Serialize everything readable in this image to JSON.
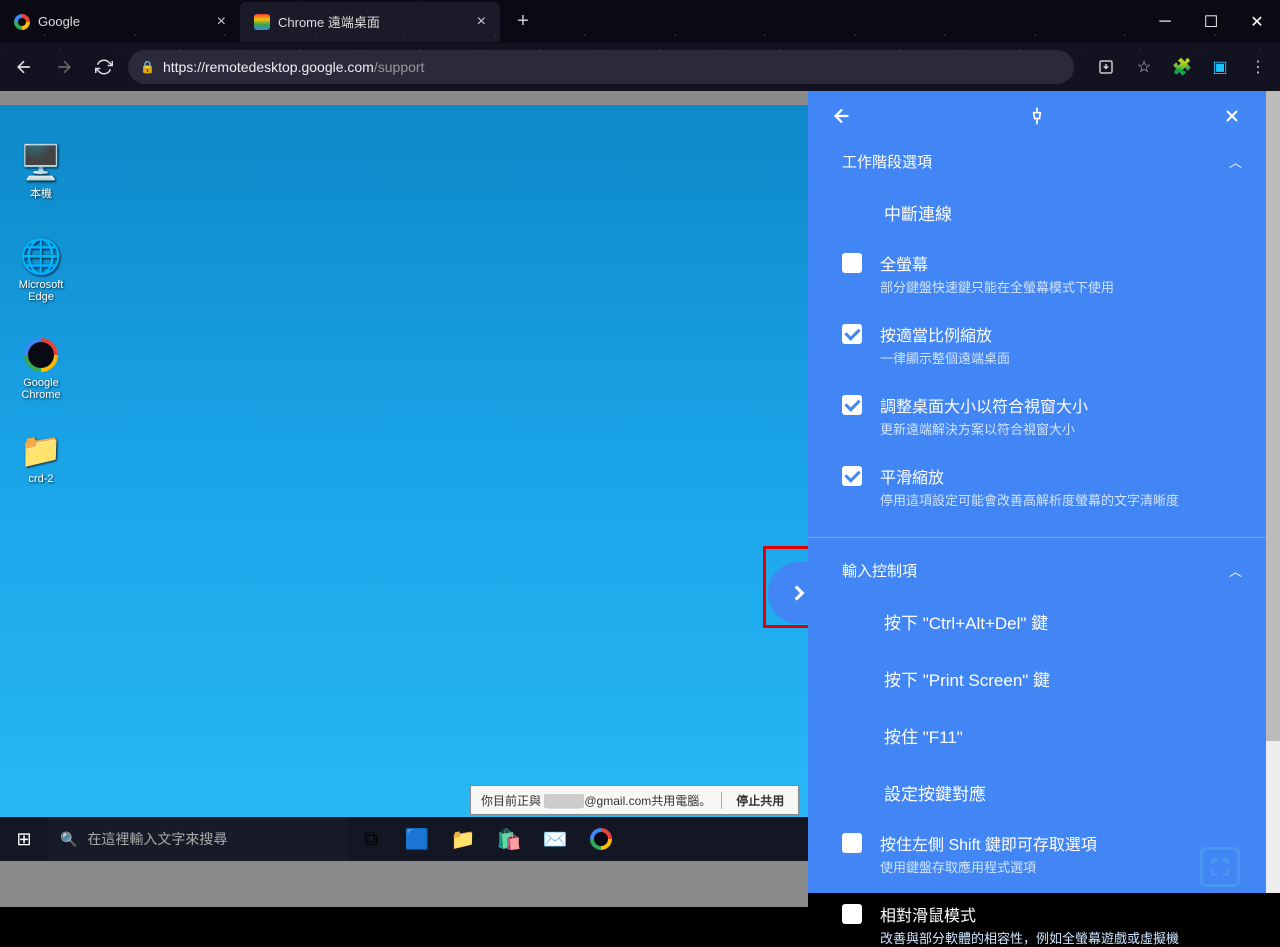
{
  "browser": {
    "tabs": [
      {
        "title": "Google",
        "active": false
      },
      {
        "title": "Chrome 遠端桌面",
        "active": true
      }
    ],
    "url_host": "https://remotedesktop.google.com",
    "url_path": "/support"
  },
  "desktop": {
    "icons": [
      {
        "label": "本機",
        "glyph": "💻"
      },
      {
        "label": "Microsoft Edge",
        "glyph": "🟦"
      },
      {
        "label": "Google Chrome",
        "glyph": "🟡"
      },
      {
        "label": "crd-2",
        "glyph": "📁"
      }
    ],
    "search_placeholder": "在這裡輸入文字來搜尋"
  },
  "share": {
    "prefix": "你目前正與",
    "suffix": "@gmail.com共用電腦。",
    "stop": "停止共用"
  },
  "panel": {
    "section1": "工作階段選項",
    "disconnect": "中斷連線",
    "options": [
      {
        "title": "全螢幕",
        "sub": "部分鍵盤快速鍵只能在全螢幕模式下使用",
        "checked": false
      },
      {
        "title": "按適當比例縮放",
        "sub": "一律顯示整個遠端桌面",
        "checked": true
      },
      {
        "title": "調整桌面大小以符合視窗大小",
        "sub": "更新遠端解決方案以符合視窗大小",
        "checked": true
      },
      {
        "title": "平滑縮放",
        "sub": "停用這項設定可能會改善高解析度螢幕的文字清晰度",
        "checked": true
      }
    ],
    "section2": "輸入控制項",
    "actions": [
      "按下 \"Ctrl+Alt+Del\" 鍵",
      "按下 \"Print Screen\" 鍵",
      "按住 \"F11\"",
      "設定按鍵對應"
    ],
    "options2": [
      {
        "title": "按住左側 Shift 鍵即可存取選項",
        "sub": "使用鍵盤存取應用程式選項",
        "checked": false
      },
      {
        "title": "相對滑鼠模式",
        "sub": "改善與部分軟體的相容性，例如全螢幕遊戲或虛擬機",
        "checked": false
      }
    ]
  }
}
